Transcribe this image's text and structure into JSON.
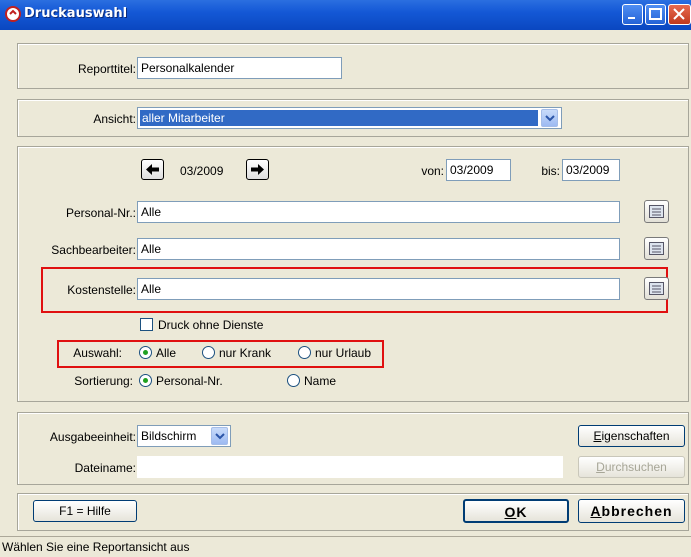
{
  "window": {
    "title": "Druckauswahl"
  },
  "report": {
    "label": "Reporttitel:",
    "value": "Personalkalender"
  },
  "view": {
    "label": "Ansicht:",
    "selected": "aller Mitarbeiter"
  },
  "period": {
    "current": "03/2009",
    "from_label": "von:",
    "from_value": "03/2009",
    "to_label": "bis:",
    "to_value": "03/2009"
  },
  "filters": {
    "personal_nr": {
      "label": "Personal-Nr.:",
      "value": "Alle"
    },
    "sachbearbeiter": {
      "label": "Sachbearbeiter:",
      "value": "Alle"
    },
    "kostenstelle": {
      "label": "Kostenstelle:",
      "value": "Alle"
    }
  },
  "options": {
    "print_without_services": {
      "label": "Druck ohne Dienste",
      "checked": false
    },
    "auswahl": {
      "label": "Auswahl:",
      "options": [
        "Alle",
        "nur Krank",
        "nur Urlaub"
      ],
      "selected": "Alle"
    },
    "sortierung": {
      "label": "Sortierung:",
      "options": [
        "Personal-Nr.",
        "Name"
      ],
      "selected": "Personal-Nr."
    }
  },
  "output": {
    "unit_label": "Ausgabeeinheit:",
    "unit_value": "Bildschirm",
    "properties_button": {
      "accel": "E",
      "rest": "igenschaften"
    },
    "filename_label": "Dateiname:",
    "filename_value": "",
    "browse_button": {
      "accel": "D",
      "rest": "urchsuchen"
    }
  },
  "buttons": {
    "help": "F1 = Hilfe",
    "ok": {
      "accel": "O",
      "rest": "K"
    },
    "cancel": {
      "accel": "A",
      "rest": "bbrechen"
    }
  },
  "status": "Wählen Sie eine Reportansicht aus",
  "colors": {
    "titlebar": "#0a47c0",
    "highlight": "#316ac5",
    "annotation": "#e01010"
  }
}
